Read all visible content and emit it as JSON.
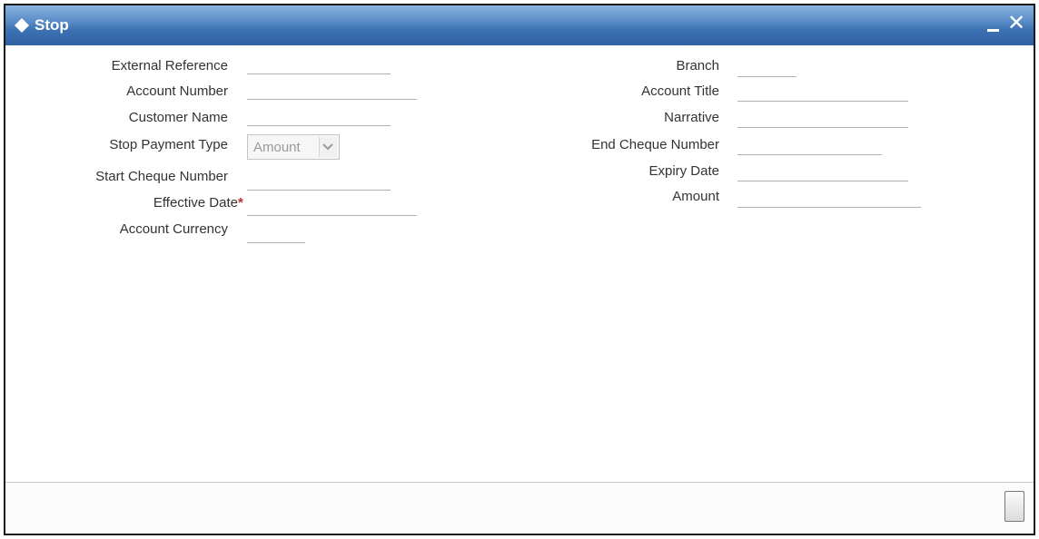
{
  "window": {
    "title": "Stop",
    "minimize_icon": "minimize-icon",
    "close_icon": "close-icon",
    "title_icon": "diamond-icon"
  },
  "form": {
    "left": {
      "external_reference": {
        "label": "External Reference",
        "value": ""
      },
      "account_number": {
        "label": "Account Number",
        "value": ""
      },
      "customer_name": {
        "label": "Customer Name",
        "value": ""
      },
      "stop_payment_type": {
        "label": "Stop Payment Type",
        "value": "Amount"
      },
      "start_cheque_number": {
        "label": "Start Cheque Number",
        "value": ""
      },
      "effective_date": {
        "label": "Effective Date",
        "required_marker": "*",
        "value": ""
      },
      "account_currency": {
        "label": "Account Currency",
        "value": ""
      }
    },
    "right": {
      "branch": {
        "label": "Branch",
        "value": ""
      },
      "account_title": {
        "label": "Account Title",
        "value": ""
      },
      "narrative": {
        "label": "Narrative",
        "value": ""
      },
      "end_cheque_number": {
        "label": "End Cheque Number",
        "value": ""
      },
      "expiry_date": {
        "label": "Expiry Date",
        "value": ""
      },
      "amount": {
        "label": "Amount",
        "value": ""
      }
    }
  },
  "colors": {
    "titlebar": "#3d72b4",
    "required": "#c0272d"
  }
}
